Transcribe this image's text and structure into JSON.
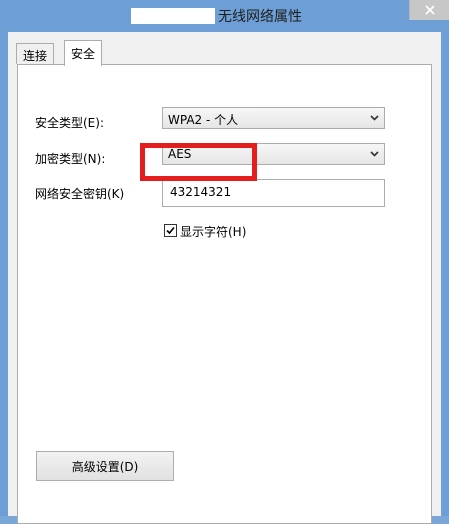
{
  "window": {
    "title": "无线网络属性",
    "close_icon": "close-icon"
  },
  "tabs": [
    {
      "label": "连接",
      "selected": false
    },
    {
      "label": "安全",
      "selected": true
    }
  ],
  "security": {
    "security_type_label": "安全类型(E):",
    "security_type_value": "WPA2 - 个人",
    "encryption_type_label": "加密类型(N):",
    "encryption_type_value": "AES",
    "network_key_label": "网络安全密钥(K)",
    "network_key_value": "43214321",
    "show_characters_label": "显示字符(H)",
    "show_characters_checked": true,
    "highlight_color": "#e41d1d"
  },
  "buttons": {
    "advanced_label": "高级设置(D)"
  }
}
